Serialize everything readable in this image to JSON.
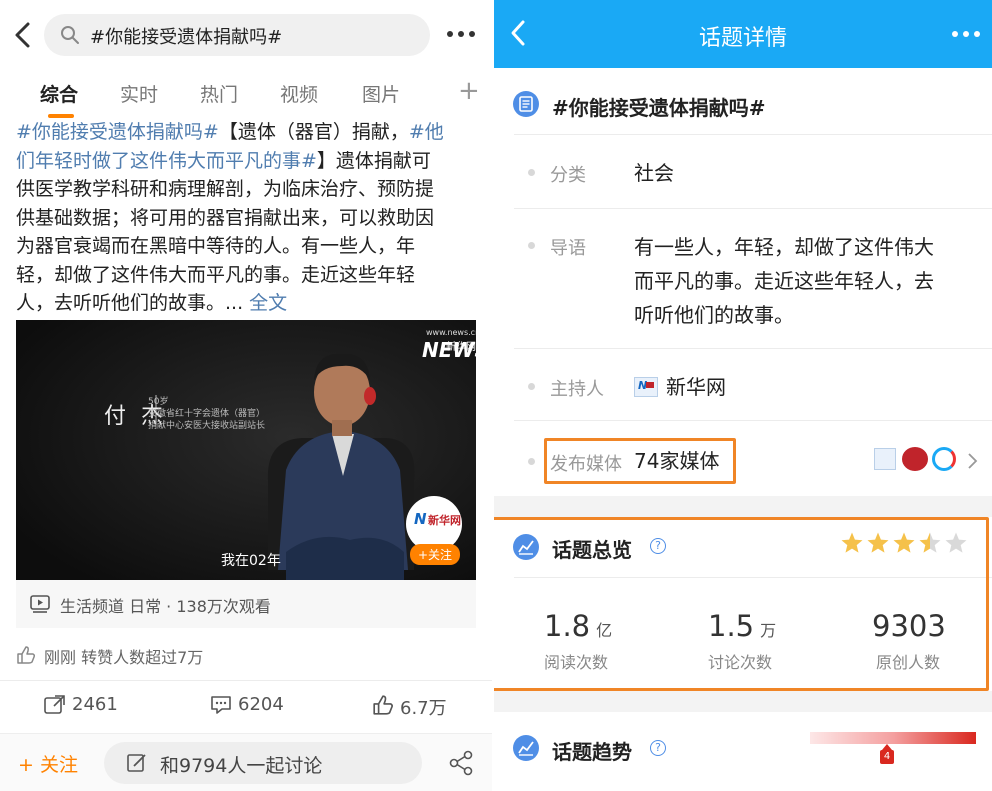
{
  "left": {
    "search_query": "#你能接受遗体捐献吗#",
    "tabs": [
      "综合",
      "实时",
      "热门",
      "视频",
      "图片"
    ],
    "active_tab": "综合",
    "post_lines": [
      [
        {
          "t": "#你能接受遗体捐献吗#",
          "hl": true
        },
        {
          "t": "【遗体（器官）捐献，",
          "hl": false
        },
        {
          "t": "#他",
          "hl": true
        }
      ],
      [
        {
          "t": "们年轻时做了这件伟大而平凡的事#",
          "hl": true
        },
        {
          "t": "】遗体捐献可",
          "hl": false
        }
      ],
      [
        {
          "t": "供医学教学科研和病理解剖，为临床治疗、预防提",
          "hl": false
        }
      ],
      [
        {
          "t": "供基础数据；将可用的器官捐献出来，可以救助因",
          "hl": false
        }
      ],
      [
        {
          "t": "为器官衰竭而在黑暗中等待的人。有一些人，年",
          "hl": false
        }
      ],
      [
        {
          "t": "轻，却做了这件伟大而平凡的事。走近这些年轻",
          "hl": false
        }
      ],
      [
        {
          "t": "人，去听听他们的故事。... ",
          "hl": false
        },
        {
          "t": "全文",
          "hl": true
        }
      ]
    ],
    "video": {
      "person_name": "付 杰",
      "person_desc_lines": [
        "50岁",
        "安徽省红十字会遗体（器官）",
        "捐献中心安医大接收站副站长"
      ],
      "subtitle": "我在02年",
      "watermark_site": "www.news.cn",
      "watermark_brand": "新华网",
      "watermark_logo_letters": "NEWS",
      "follow_badge": "+关注"
    },
    "video_meta": "生活频道 日常 · 138万次观看",
    "likes_note": "刚刚 转赞人数超过7万",
    "actions": {
      "repost": "2461",
      "comment": "6204",
      "like": "6.7万"
    },
    "bottom": {
      "follow": "+ 关注",
      "discuss": "和9794人一起讨论"
    }
  },
  "right": {
    "nav_title": "话题详情",
    "topic_title": "#你能接受遗体捐献吗#",
    "category_label": "分类",
    "category_value": "社会",
    "intro_label": "导语",
    "intro_lines": [
      "有一些人，年轻，却做了这件伟大",
      "而平凡的事。走近这些年轻人，去",
      "听听他们的故事。"
    ],
    "host_label": "主持人",
    "host_value": "新华网",
    "media_label": "发布媒体",
    "media_value": "74家媒体",
    "overview": {
      "title": "话题总览",
      "rating_stars": 3.5,
      "stats": [
        {
          "value": "1.8",
          "unit": "亿",
          "label": "阅读次数"
        },
        {
          "value": "1.5",
          "unit": "万",
          "label": "讨论次数"
        },
        {
          "value": "9303",
          "unit": "",
          "label": "原创人数"
        }
      ]
    },
    "trend": {
      "title": "话题趋势",
      "marker": "4"
    },
    "colors": {
      "nav": "#1aa9f5",
      "accent": "#ff8200",
      "highlight_box": "#f08526",
      "star": "#f5c14a"
    }
  }
}
